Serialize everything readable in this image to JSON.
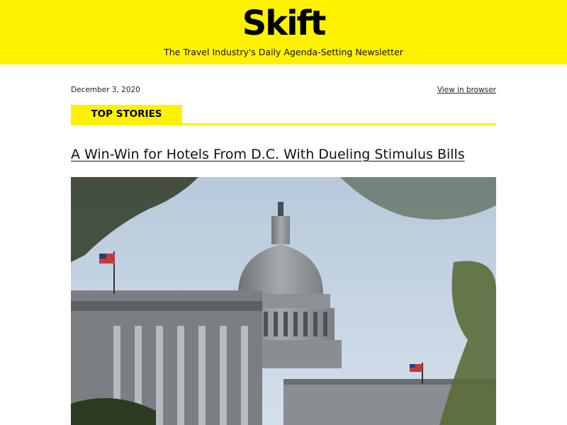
{
  "header": {
    "logo_text": "Skift",
    "tagline": "The Travel Industry's Daily Agenda-Setting Newsletter",
    "background": "#fff200"
  },
  "meta": {
    "date": "December 3, 2020",
    "view_in_browser": "View in browser"
  },
  "section": {
    "title": "TOP STORIES"
  },
  "story": {
    "headline": "A Win-Win for Hotels From D.C. With Dueling Stimulus Bills",
    "image_icon": "capitol-photo"
  }
}
